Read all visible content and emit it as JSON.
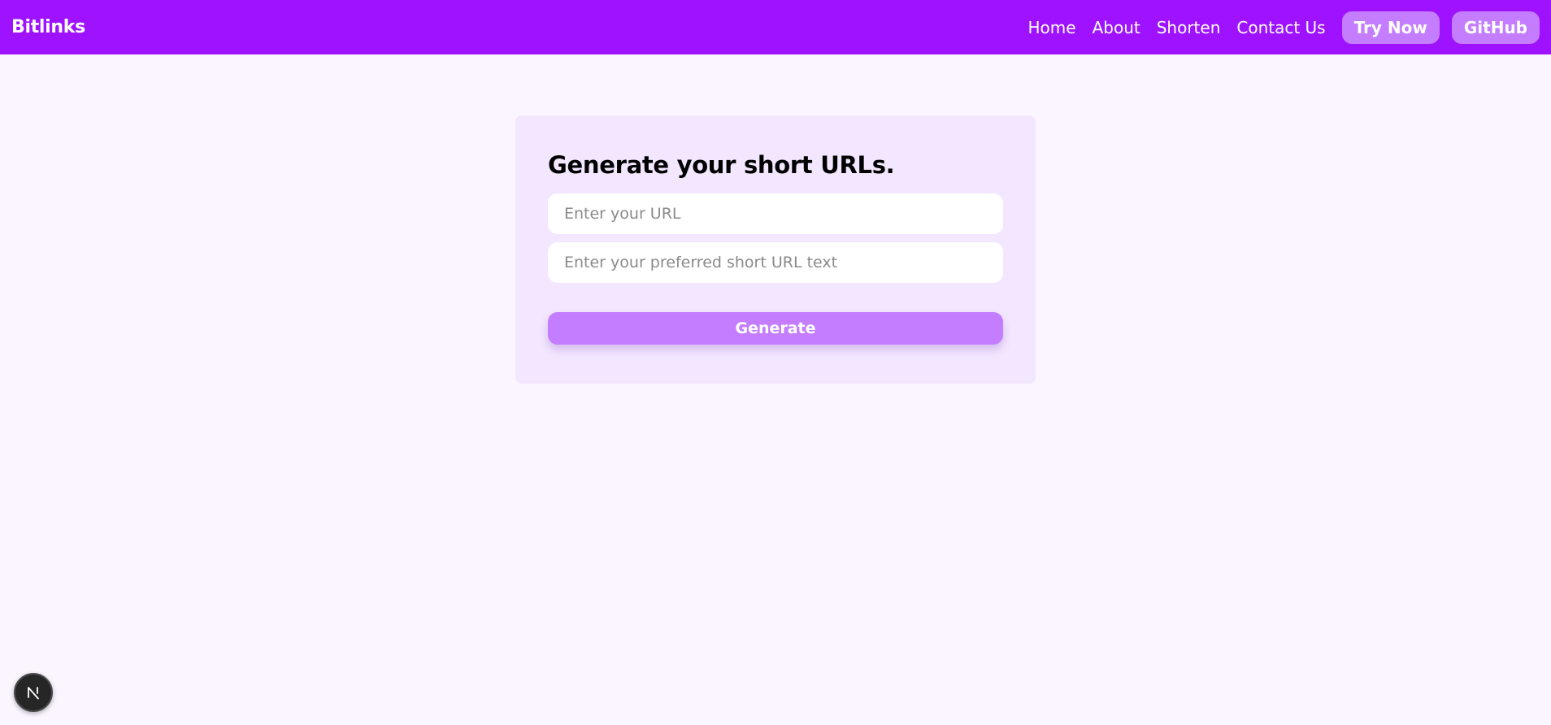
{
  "navbar": {
    "brand": "Bitlinks",
    "links": [
      "Home",
      "About",
      "Shorten",
      "Contact Us"
    ],
    "try_now_label": "Try Now",
    "github_label": "GitHub",
    "background_color": "#9e12ff",
    "button_color": "#c47dff"
  },
  "form": {
    "title": "Generate your short URLs.",
    "url_placeholder": "Enter your URL",
    "url_value": "",
    "short_text_placeholder": "Enter your preferred short URL text",
    "short_text_value": "",
    "generate_label": "Generate",
    "card_color": "#f3e6ff"
  },
  "dev_badge": {
    "icon": "nextjs-logo-icon"
  }
}
